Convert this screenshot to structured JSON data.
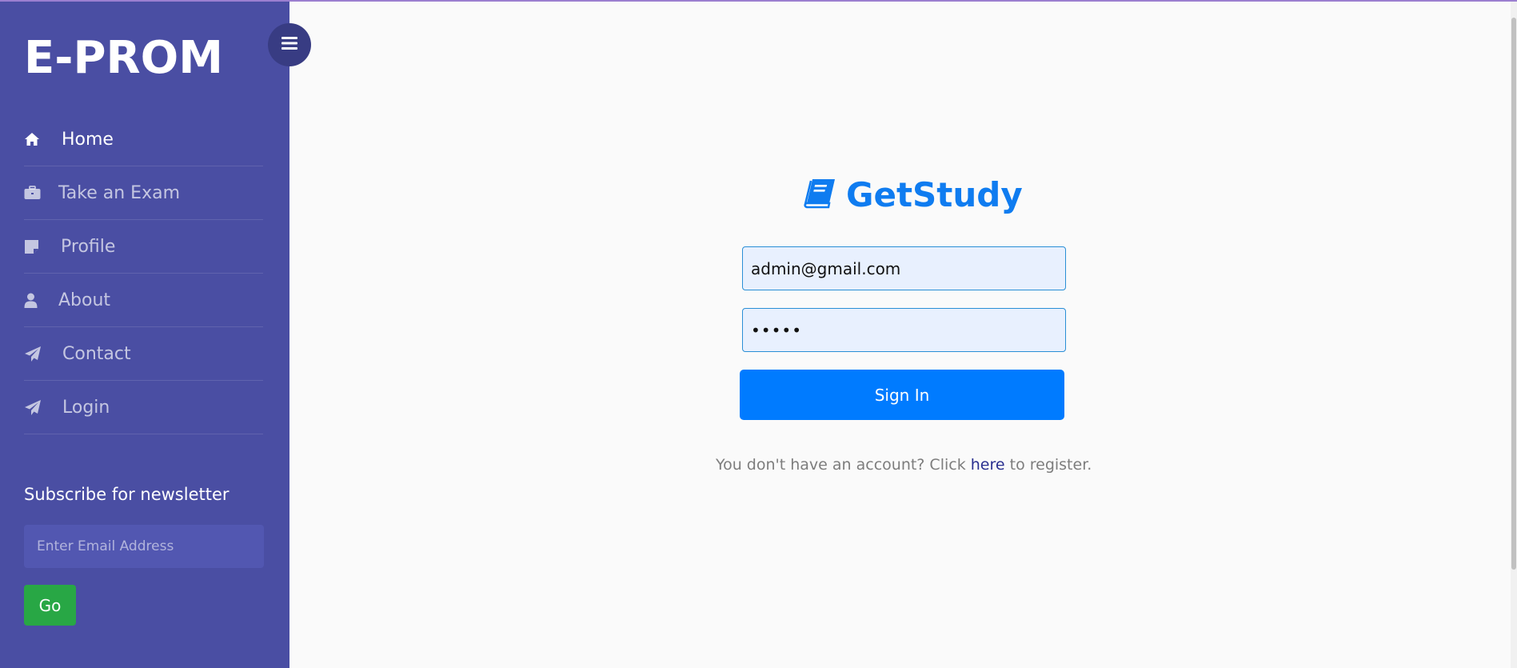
{
  "sidebar": {
    "brand": "E-PROM",
    "toggle_icon": "hamburger-icon",
    "items": [
      {
        "label": "Home",
        "icon": "home-icon",
        "active": true
      },
      {
        "label": "Take an Exam",
        "icon": "briefcase-icon",
        "active": false
      },
      {
        "label": "Profile",
        "icon": "sticky-note-icon",
        "active": false
      },
      {
        "label": "About",
        "icon": "user-icon",
        "active": false
      },
      {
        "label": "Contact",
        "icon": "paper-plane-icon",
        "active": false
      },
      {
        "label": "Login",
        "icon": "paper-plane-icon",
        "active": false
      }
    ],
    "newsletter": {
      "title": "Subscribe for newsletter",
      "placeholder": "Enter Email Address",
      "button_label": "Go"
    }
  },
  "login": {
    "logo_text": "GetStudy",
    "logo_icon": "book-icon",
    "email_value": "admin@gmail.com",
    "password_value": "•••••",
    "signin_label": "Sign In",
    "register_prefix": "You don't have an account? Click ",
    "register_link": "here",
    "register_suffix": " to register."
  },
  "colors": {
    "sidebar_bg": "#4a4ea3",
    "accent_blue": "#007bff",
    "go_green": "#28a745",
    "logo_blue": "#0f7cf0"
  }
}
